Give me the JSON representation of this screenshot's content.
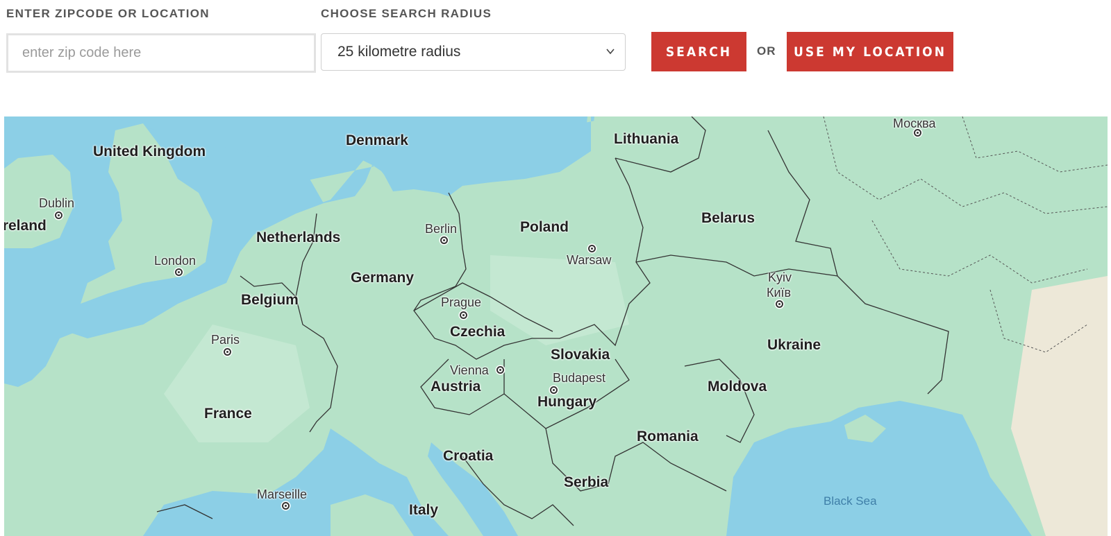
{
  "form": {
    "zip_label": "ENTER ZIPCODE OR LOCATION",
    "zip_placeholder": "enter zip code here",
    "radius_label": "CHOOSE SEARCH RADIUS",
    "radius_selected": "25 kilometre radius",
    "search_button": "SEARCH",
    "or_text": "OR",
    "location_button": "USE MY LOCATION"
  },
  "map": {
    "countries": [
      "United Kingdom",
      "Ireland",
      "Denmark",
      "Lithuania",
      "Netherlands",
      "Belgium",
      "Germany",
      "Poland",
      "Belarus",
      "Czechia",
      "Slovakia",
      "Austria",
      "Hungary",
      "France",
      "Ukraine",
      "Moldova",
      "Romania",
      "Croatia",
      "Serbia",
      "Italy"
    ],
    "cities": [
      "Dublin",
      "London",
      "Paris",
      "Marseille",
      "Berlin",
      "Warsaw",
      "Prague",
      "Vienna",
      "Budapest",
      "Kyiv",
      "Київ",
      "Москва"
    ],
    "seas": [
      "Black Sea"
    ],
    "colors": {
      "water": "#8ccfe6",
      "land": "#b6e2c8",
      "land_alt": "#c4e8d2",
      "border": "#333333"
    }
  }
}
